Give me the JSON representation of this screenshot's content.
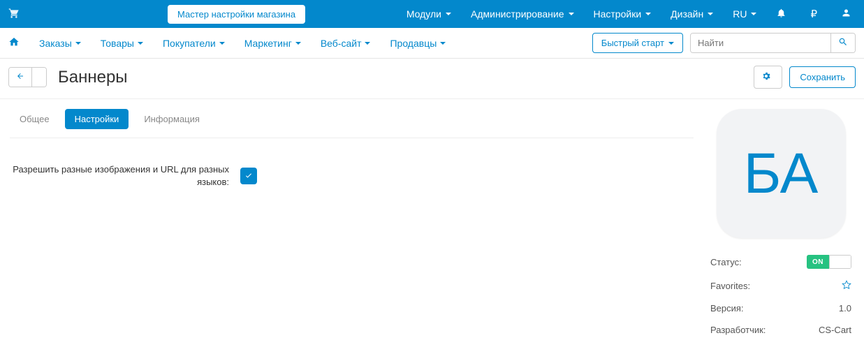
{
  "topbar": {
    "wizard": "Мастер настройки магазина",
    "menus": [
      "Модули",
      "Администрирование",
      "Настройки",
      "Дизайн"
    ],
    "lang": "RU",
    "currency": "₽"
  },
  "nav": {
    "items": [
      "Заказы",
      "Товары",
      "Покупатели",
      "Маркетинг",
      "Веб-сайт",
      "Продавцы"
    ],
    "quick_start": "Быстрый старт",
    "search_placeholder": "Найти"
  },
  "page": {
    "title": "Баннеры",
    "save": "Сохранить"
  },
  "tabs": [
    "Общее",
    "Настройки",
    "Информация"
  ],
  "form": {
    "allow_images_label": "Разрешить разные изображения и URL для разных языков:"
  },
  "sidebar": {
    "icon_text": "БА",
    "status_label": "Статус:",
    "toggle_on": "ON",
    "favorites_label": "Favorites:",
    "version_label": "Версия:",
    "version_value": "1.0",
    "developer_label": "Разработчик:",
    "developer_value": "CS-Cart"
  }
}
